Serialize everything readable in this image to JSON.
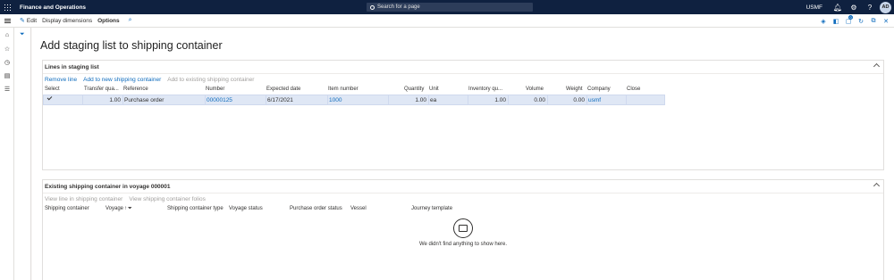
{
  "app": {
    "title": "Finance and Operations",
    "search_placeholder": "Search for a page",
    "company": "USMF",
    "user_initials": "AD"
  },
  "action_pane": {
    "edit_label": "Edit",
    "display_dimensions_label": "Display dimensions",
    "options_label": "Options",
    "notifications_count": "0"
  },
  "page": {
    "title": "Add staging list to shipping container"
  },
  "staging_section": {
    "title": "Lines in staging list",
    "toolbar": {
      "remove_line": "Remove line",
      "add_new_container": "Add to new shipping container",
      "add_existing_container": "Add to existing shipping container"
    },
    "columns": {
      "select": "Select",
      "transfer_qty": "Transfer qua...",
      "reference": "Reference",
      "number": "Number",
      "expected_date": "Expected date",
      "item_number": "Item number",
      "quantity": "Quantity",
      "unit": "Unit",
      "inventory_qty": "Inventory qu...",
      "volume": "Volume",
      "weight": "Weight",
      "company": "Company",
      "close": "Close"
    },
    "rows": [
      {
        "transfer_qty": "1.00",
        "reference": "Purchase order",
        "number": "00000125",
        "expected_date": "6/17/2021",
        "item_number": "1000",
        "quantity": "1.00",
        "unit": "ea",
        "inventory_qty": "1.00",
        "volume": "0.00",
        "weight": "0.00",
        "company": "usmf",
        "close": ""
      }
    ]
  },
  "container_section": {
    "title": "Existing shipping container in voyage 000001",
    "toolbar": {
      "view_line": "View line in shipping container",
      "view_folios": "View shipping container folios"
    },
    "columns": {
      "shipping_container": "Shipping container",
      "voyage": "Voyage",
      "container_type": "Shipping container type",
      "voyage_status": "Voyage status",
      "po_status": "Purchase order status",
      "vessel": "Vessel",
      "journey_template": "Journey template"
    },
    "empty_message": "We didn't find anything to show here."
  },
  "colors": {
    "nav_bar": "#0f2140",
    "accent": "#0f6cbd",
    "selected_row": "#dfe7f5"
  }
}
